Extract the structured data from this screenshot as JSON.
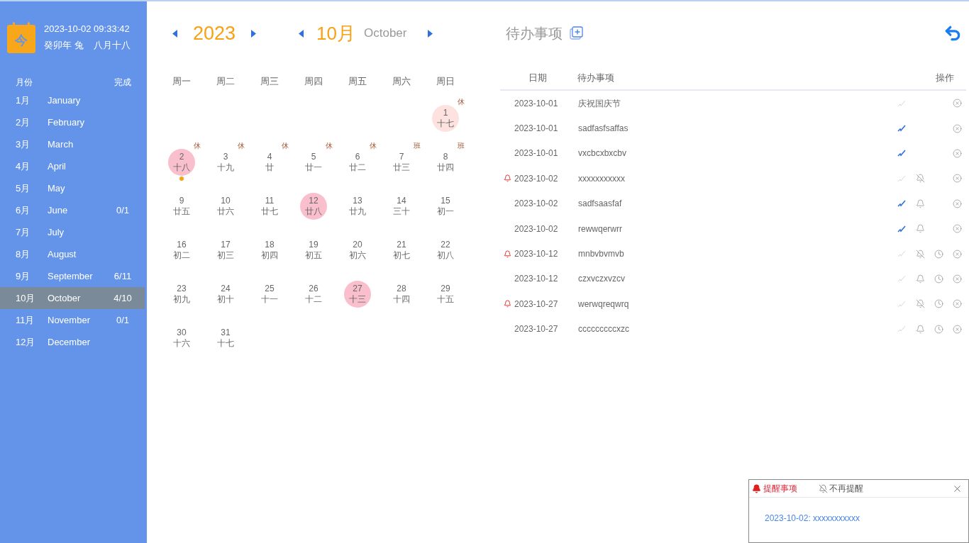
{
  "today": {
    "logo_char": "今",
    "datetime": "2023-10-02 09:33:42",
    "lunar_year": "癸卯年 兔",
    "lunar_date": "八月十八"
  },
  "months": {
    "columns": [
      "月份",
      "完成"
    ],
    "items": [
      {
        "num": "1月",
        "name": "January",
        "selected": false
      },
      {
        "num": "2月",
        "name": "February",
        "selected": false
      },
      {
        "num": "3月",
        "name": "March",
        "selected": false
      },
      {
        "num": "4月",
        "name": "April",
        "selected": false
      },
      {
        "num": "5月",
        "name": "May",
        "selected": false
      },
      {
        "num": "6月",
        "name": "June",
        "done": "0/1",
        "selected": false
      },
      {
        "num": "7月",
        "name": "July",
        "selected": false
      },
      {
        "num": "8月",
        "name": "August",
        "selected": false
      },
      {
        "num": "9月",
        "name": "September",
        "done": "6/11",
        "selected": false
      },
      {
        "num": "10月",
        "name": "October",
        "done": "4/10",
        "selected": true
      },
      {
        "num": "11月",
        "name": "November",
        "done": "0/1",
        "selected": false
      },
      {
        "num": "12月",
        "name": "December",
        "selected": false
      }
    ]
  },
  "calendar": {
    "year": "2023",
    "month": "10月",
    "month_name": "October",
    "weekdays": [
      "周一",
      "周二",
      "周三",
      "周四",
      "周五",
      "周六",
      "周日"
    ],
    "weeks": [
      {
        "kind": "trailing",
        "days": [
          {
            "day": "1",
            "lunar": "十七",
            "badge": "休",
            "color": "#fde2df"
          }
        ]
      },
      {
        "kind": "leading",
        "days": [
          {
            "day": "2",
            "lunar": "十八",
            "badge": "休",
            "color": "#f9bfcc",
            "dot": true
          },
          {
            "day": "3",
            "lunar": "十九",
            "badge": "休"
          },
          {
            "day": "4",
            "lunar": "廿",
            "badge": "休"
          },
          {
            "day": "5",
            "lunar": "廿一",
            "badge": "休"
          },
          {
            "day": "6",
            "lunar": "廿二",
            "badge": "休"
          },
          {
            "day": "7",
            "lunar": "廿三",
            "badge": "班"
          },
          {
            "day": "8",
            "lunar": "廿四",
            "badge": "班"
          }
        ]
      },
      {
        "kind": "leading",
        "days": [
          {
            "day": "9",
            "lunar": "廿五"
          },
          {
            "day": "10",
            "lunar": "廿六"
          },
          {
            "day": "11",
            "lunar": "廿七"
          },
          {
            "day": "12",
            "lunar": "廿八",
            "color": "#f9bfcc"
          },
          {
            "day": "13",
            "lunar": "廿九"
          },
          {
            "day": "14",
            "lunar": "三十"
          },
          {
            "day": "15",
            "lunar": "初一"
          }
        ]
      },
      {
        "kind": "leading",
        "days": [
          {
            "day": "16",
            "lunar": "初二"
          },
          {
            "day": "17",
            "lunar": "初三"
          },
          {
            "day": "18",
            "lunar": "初四"
          },
          {
            "day": "19",
            "lunar": "初五"
          },
          {
            "day": "20",
            "lunar": "初六"
          },
          {
            "day": "21",
            "lunar": "初七"
          },
          {
            "day": "22",
            "lunar": "初八"
          }
        ]
      },
      {
        "kind": "leading",
        "days": [
          {
            "day": "23",
            "lunar": "初九"
          },
          {
            "day": "24",
            "lunar": "初十"
          },
          {
            "day": "25",
            "lunar": "十一"
          },
          {
            "day": "26",
            "lunar": "十二"
          },
          {
            "day": "27",
            "lunar": "十三",
            "color": "#f9bfcc"
          },
          {
            "day": "28",
            "lunar": "十四"
          },
          {
            "day": "29",
            "lunar": "十五"
          }
        ]
      },
      {
        "kind": "leading",
        "days": [
          {
            "day": "30",
            "lunar": "十六"
          },
          {
            "day": "31",
            "lunar": "十七"
          }
        ]
      }
    ]
  },
  "todos": {
    "title": "待办事项",
    "columns": [
      "日期",
      "待办事项",
      "操作"
    ],
    "rows": [
      {
        "date": "2023-10-01",
        "text": "庆祝国庆节",
        "alarm": false,
        "done": false,
        "bell": false,
        "clock": false
      },
      {
        "date": "2023-10-01",
        "text": "sadfasfsaffas",
        "alarm": false,
        "done": true,
        "bell": false,
        "clock": false
      },
      {
        "date": "2023-10-01",
        "text": "vxcbcxbxcbv",
        "alarm": false,
        "done": true,
        "bell": false,
        "clock": false
      },
      {
        "date": "2023-10-02",
        "text": "xxxxxxxxxxx",
        "alarm": true,
        "done": false,
        "bell": true,
        "muted": true,
        "clock": false
      },
      {
        "date": "2023-10-02",
        "text": "sadfsaasfaf",
        "alarm": false,
        "done": true,
        "bell": true,
        "muted": false,
        "clock": false
      },
      {
        "date": "2023-10-02",
        "text": "rewwqerwrr",
        "alarm": false,
        "done": true,
        "bell": true,
        "muted": false,
        "clock": false
      },
      {
        "date": "2023-10-12",
        "text": "mnbvbvmvb",
        "alarm": true,
        "done": false,
        "bell": true,
        "muted": true,
        "clock": true
      },
      {
        "date": "2023-10-12",
        "text": "czxvczxvzcv",
        "alarm": false,
        "done": false,
        "bell": true,
        "muted": false,
        "clock": true
      },
      {
        "date": "2023-10-27",
        "text": "werwqreqwrq",
        "alarm": true,
        "done": false,
        "bell": true,
        "muted": true,
        "clock": true
      },
      {
        "date": "2023-10-27",
        "text": "cccccccccxzc",
        "alarm": false,
        "done": false,
        "bell": true,
        "muted": false,
        "clock": true
      }
    ]
  },
  "reminder": {
    "title": "提醒事项",
    "mute_label": "不再提醒",
    "message": "2023-10-02: xxxxxxxxxxx"
  }
}
